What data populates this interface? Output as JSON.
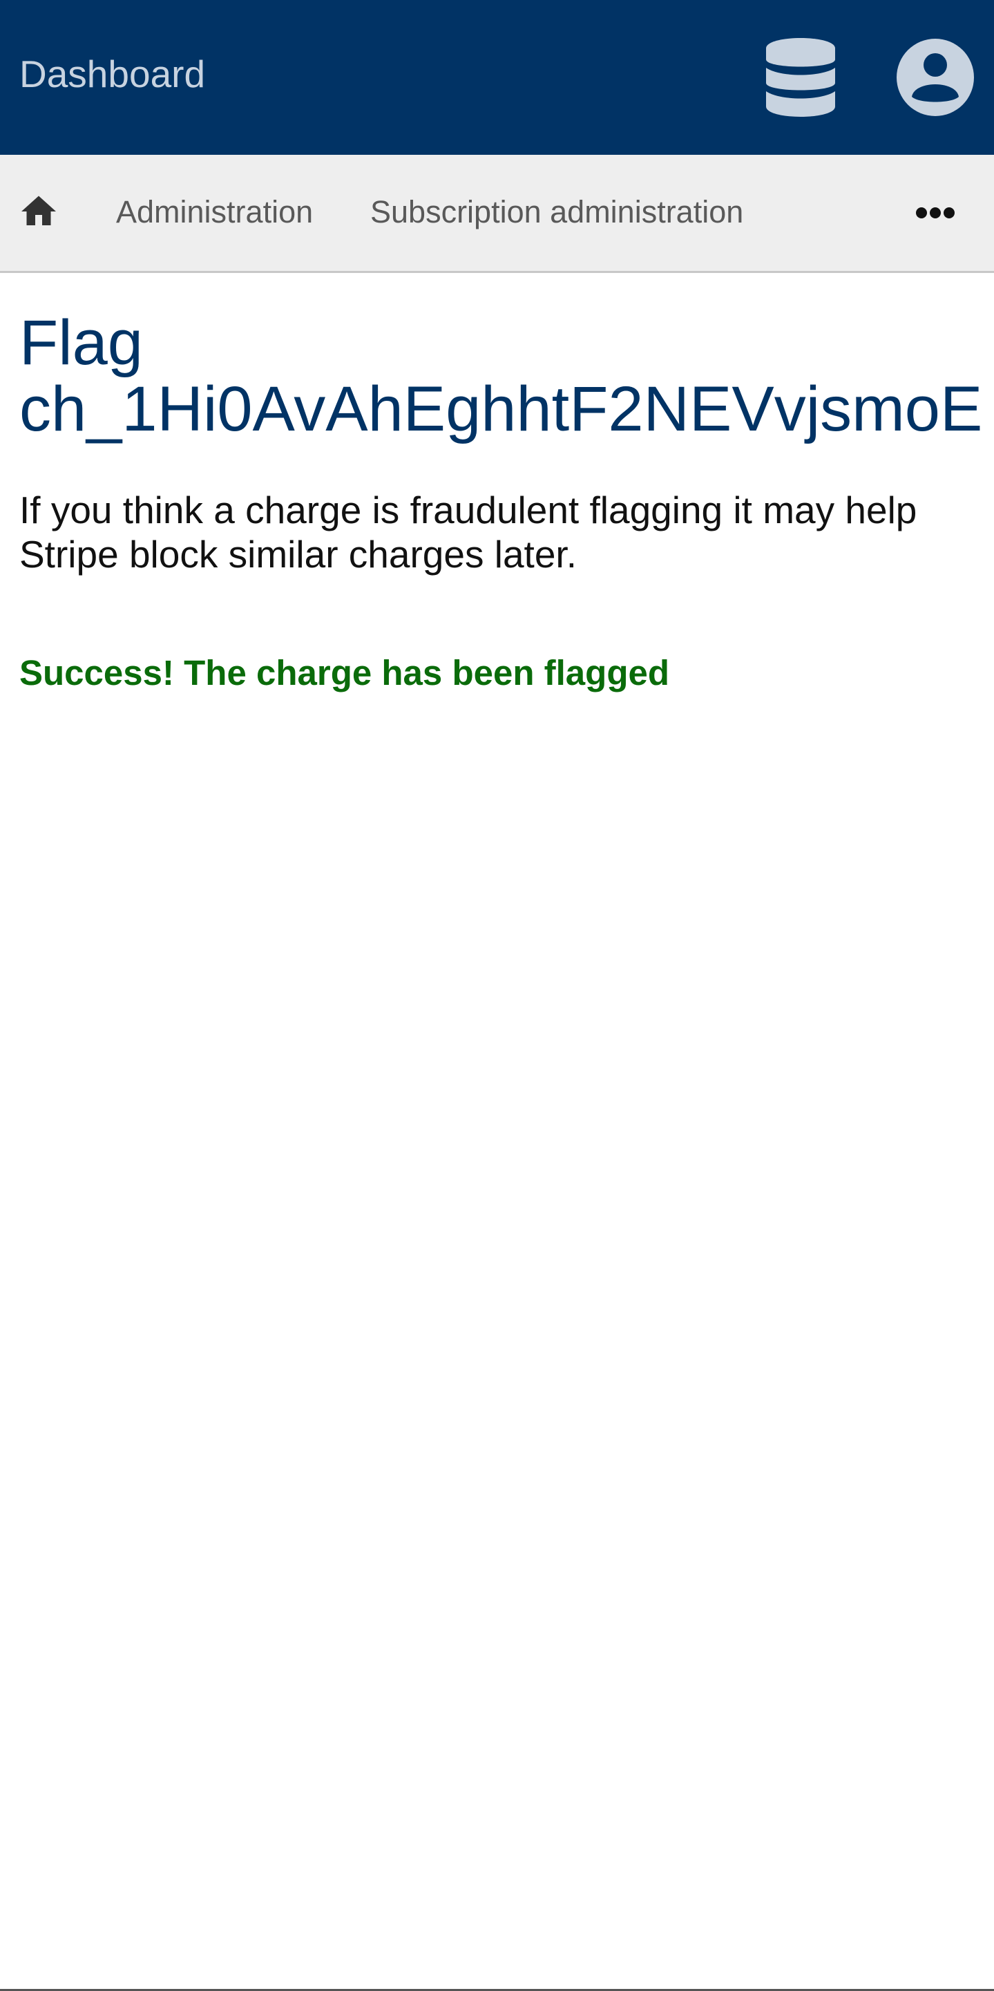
{
  "header": {
    "brand": "Dashboard",
    "background_color": "#013365",
    "icons": [
      "database-icon",
      "account-circle-icon"
    ]
  },
  "nav": {
    "home_icon": "home-icon",
    "items": [
      {
        "label": "Administration"
      },
      {
        "label": "Subscription administration"
      }
    ],
    "more_icon": "more-horizontal-icon"
  },
  "main": {
    "title_line1": "Flag",
    "title_line2": "ch_1Hi0AvAhEghhtF2NEVvjsmoE",
    "intro_line1": "If you think a charge is fraudulent flagging it may help",
    "intro_line2": "Stripe block similar charges later.",
    "success_message": "Success! The charge has been flagged",
    "title_color": "#013365",
    "success_color": "#0a6b0a"
  }
}
